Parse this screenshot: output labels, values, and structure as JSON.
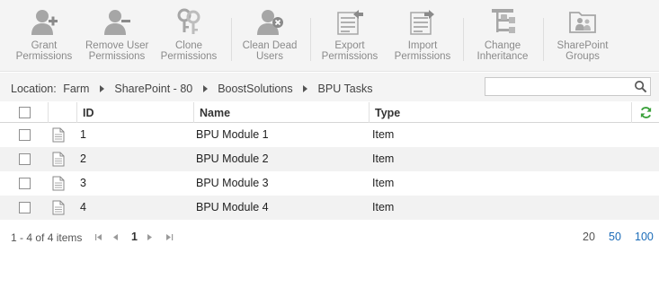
{
  "ribbon": {
    "items": [
      {
        "line1": "Grant",
        "line2": "Permissions",
        "icon": "user-add-icon"
      },
      {
        "line1": "Remove User",
        "line2": "Permissions",
        "icon": "user-remove-icon"
      },
      {
        "line1": "Clone",
        "line2": "Permissions",
        "icon": "clone-keys-icon"
      },
      {
        "line1": "Clean Dead",
        "line2": "Users",
        "icon": "user-clean-icon"
      },
      {
        "line1": "Export",
        "line2": "Permissions",
        "icon": "export-icon"
      },
      {
        "line1": "Import",
        "line2": "Permissions",
        "icon": "import-icon"
      },
      {
        "line1": "Change",
        "line2": "Inheritance",
        "icon": "inheritance-icon"
      },
      {
        "line1": "SharePoint",
        "line2": "Groups",
        "icon": "group-folder-icon"
      }
    ]
  },
  "location": {
    "label": "Location:",
    "crumbs": [
      "Farm",
      "SharePoint - 80",
      "BoostSolutions",
      "BPU Tasks"
    ]
  },
  "search": {
    "placeholder": "",
    "value": ""
  },
  "grid": {
    "headers": {
      "id": "ID",
      "name": "Name",
      "type": "Type"
    },
    "rows": [
      {
        "id": "1",
        "name": "BPU Module 1",
        "type": "Item"
      },
      {
        "id": "2",
        "name": "BPU Module 2",
        "type": "Item"
      },
      {
        "id": "3",
        "name": "BPU Module 3",
        "type": "Item"
      },
      {
        "id": "4",
        "name": "BPU Module 4",
        "type": "Item"
      }
    ]
  },
  "pager": {
    "info": "1 - 4 of 4 items",
    "current_page": "1",
    "sizes": [
      "20",
      "50",
      "100"
    ]
  },
  "colors": {
    "link": "#1a6bb8",
    "ribbon_bg": "#f4f4f4",
    "icon": "#9a9a9a",
    "refresh": "#3aa13a"
  }
}
